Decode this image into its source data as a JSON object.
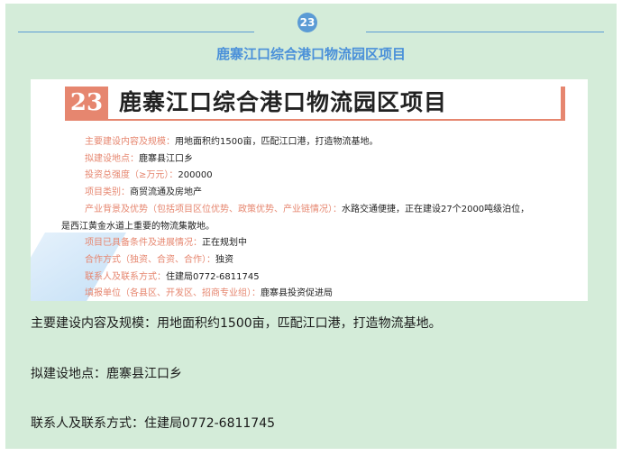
{
  "header": {
    "badge": "23",
    "title": "鹿寨江口综合港口物流园区项目"
  },
  "card": {
    "number": "23",
    "title": "鹿寨江口综合港口物流园区项目",
    "rows": [
      {
        "key": "主要建设内容及规模：",
        "value": "用地面积约1500亩，匹配江口港，打造物流基地。"
      },
      {
        "key": "拟建设地点：",
        "value": "鹿寨县江口乡"
      },
      {
        "key": "投资总强度（≥万元）：",
        "value": "200000"
      },
      {
        "key": "项目类别：",
        "value": "商贸流通及房地产"
      },
      {
        "key": "产业背景及优势（包括项目区位优势、政策优势、产业链情况）：",
        "value": "水路交通便捷，正在建设27个2000吨级泊位，",
        "cont": "是西江黄金水道上重要的物流集散地。"
      },
      {
        "key": "项目已具备条件及进展情况：",
        "value": "正在规划中"
      },
      {
        "key": "合作方式（独资、合资、合作）：",
        "value": "独资"
      },
      {
        "key": "联系人及联系方式：",
        "value": "住建局0772-6811745"
      },
      {
        "key": "填报单位（各县区、开发区、招商专业组）：",
        "value": "鹿寨县投资促进局"
      }
    ]
  },
  "body": {
    "line1": "主要建设内容及规模：用地面积约1500亩，匹配江口港，打造物流基地。",
    "line2": "拟建设地点：鹿寨县江口乡",
    "line3": "联系人及联系方式：住建局0772-6811745"
  },
  "colors": {
    "panel_bg": "#d4ecd9",
    "accent_blue": "#5b9bd5",
    "title_blue": "#4a90d9",
    "card_accent": "#e6866f"
  }
}
